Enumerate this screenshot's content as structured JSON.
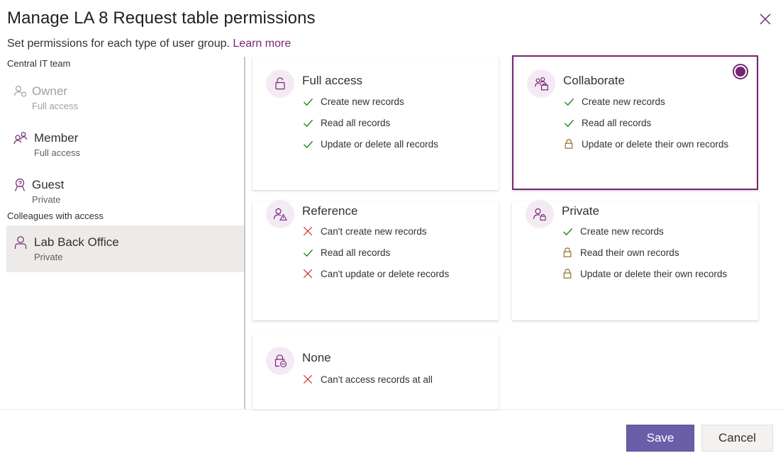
{
  "dialog": {
    "title": "Manage LA 8 Request table permissions",
    "subtitle": "Set permissions for each type of user group.",
    "learn_more": "Learn more"
  },
  "sidebar": {
    "section_central": "Central IT team",
    "section_colleagues": "Colleagues with access",
    "groups": [
      {
        "name": "Owner",
        "sub": "Full access",
        "icon": "owner-icon",
        "state": "disabled"
      },
      {
        "name": "Member",
        "sub": "Full access",
        "icon": "member-icon",
        "state": "normal"
      },
      {
        "name": "Guest",
        "sub": "Private",
        "icon": "guest-icon",
        "state": "normal"
      },
      {
        "name": "Lab Back Office",
        "sub": "Private",
        "icon": "person-icon",
        "state": "selected"
      }
    ]
  },
  "cards": [
    {
      "title": "Full access",
      "icon": "unlock-icon",
      "selected": false,
      "rows": [
        {
          "icon": "check",
          "text": "Create new records"
        },
        {
          "icon": "check",
          "text": "Read all records"
        },
        {
          "icon": "check",
          "text": "Update or delete all records"
        }
      ]
    },
    {
      "title": "Collaborate",
      "icon": "people-team-icon",
      "selected": true,
      "rows": [
        {
          "icon": "check",
          "text": "Create new records"
        },
        {
          "icon": "check",
          "text": "Read all records"
        },
        {
          "icon": "lock",
          "text": "Update or delete their own records"
        }
      ]
    },
    {
      "title": "Reference",
      "icon": "person-warning-icon",
      "selected": false,
      "rows": [
        {
          "icon": "cross",
          "text": "Can't create new records"
        },
        {
          "icon": "check",
          "text": "Read all records"
        },
        {
          "icon": "cross",
          "text": "Can't update or delete records"
        }
      ]
    },
    {
      "title": "Private",
      "icon": "person-lock-icon",
      "selected": false,
      "rows": [
        {
          "icon": "check",
          "text": "Create new records"
        },
        {
          "icon": "lock",
          "text": "Read their own records"
        },
        {
          "icon": "lock",
          "text": "Update or delete their own records"
        }
      ]
    },
    {
      "title": "None",
      "icon": "lock-blocked-icon",
      "selected": false,
      "rows": [
        {
          "icon": "cross",
          "text": "Can't access records at all"
        }
      ]
    }
  ],
  "footer": {
    "save": "Save",
    "cancel": "Cancel"
  },
  "colors": {
    "accent": "#742774",
    "check": "#107c10",
    "cross": "#d13438",
    "lock": "#8a6a18",
    "save_bg": "#6b5ea8"
  }
}
